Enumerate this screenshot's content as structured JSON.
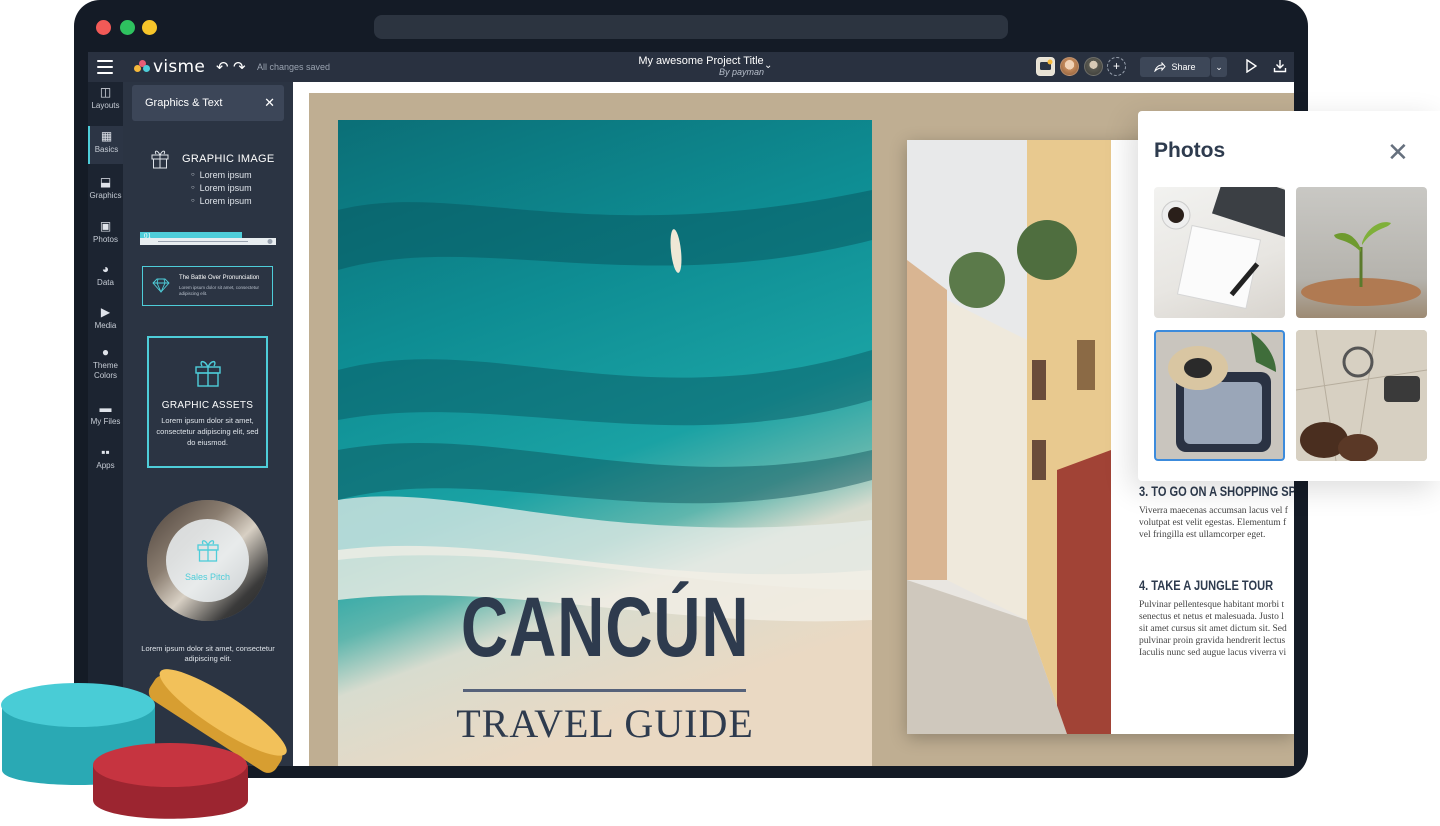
{
  "app": {
    "brand": "visme",
    "saved_status": "All changes saved",
    "project_title": "My awesome Project Title",
    "project_author": "By payman",
    "share_label": "Share"
  },
  "colors": {
    "accent": "#4ecdd9",
    "dark": "#293140",
    "canvas_bg": "#bfae92",
    "heading": "#2e3b4e"
  },
  "nav": {
    "items": [
      {
        "label": "Layouts",
        "icon": "layout-icon"
      },
      {
        "label": "Basics",
        "icon": "shapes-icon"
      },
      {
        "label": "Graphics",
        "icon": "graphics-icon"
      },
      {
        "label": "Photos",
        "icon": "photo-icon"
      },
      {
        "label": "Data",
        "icon": "chart-icon"
      },
      {
        "label": "Media",
        "icon": "video-icon"
      },
      {
        "label": "Theme Colors",
        "icon": "palette-icon"
      },
      {
        "label": "My Files",
        "icon": "folder-icon"
      },
      {
        "label": "Apps",
        "icon": "apps-icon"
      }
    ]
  },
  "panel": {
    "title": "Graphics & Text",
    "graphic_image": {
      "title": "GRAPHIC IMAGE",
      "items": [
        "Lorem ipsum",
        "Lorem ipsum",
        "Lorem ipsum"
      ]
    },
    "ribbon_number": "01",
    "battle": {
      "title": "The Battle Over Pronunciation",
      "body": "Lorem ipsum dolor sit amet, consectetur adipiscing elit."
    },
    "assets": {
      "title": "GRAPHIC ASSETS",
      "body": "Lorem ipsum dolor sit amet, consectetur adipiscing elit, sed do eiusmod."
    },
    "pitch": {
      "label": "Sales Pitch",
      "caption": "Lorem ipsum dolor sit amet, consectetur adipiscing elit."
    }
  },
  "cover": {
    "title": "CANCÚN",
    "subtitle": "TRAVEL GUIDE"
  },
  "spread": {
    "sections": [
      {
        "heading": "3. TO GO ON A SHOPPING SPR",
        "lines": [
          "Viverra maecenas accumsan lacus vel f",
          "volutpat est velit egestas. Elementum f",
          "vel fringilla est ullamcorper eget."
        ]
      },
      {
        "heading": "4. TAKE A JUNGLE TOUR",
        "lines": [
          "Pulvinar pellentesque habitant morbi t",
          "senectus et netus et malesuada. Justo l",
          "sit amet cursus sit amet dictum sit. Sed",
          "pulvinar proin gravida hendrerit lectus",
          "Iaculis nunc sed augue lacus viverra vi"
        ]
      }
    ]
  },
  "photos_panel": {
    "title": "Photos",
    "thumbs": [
      "planner-photo",
      "plant-coins-photo",
      "suitcase-photo",
      "map-boots-photo"
    ]
  }
}
